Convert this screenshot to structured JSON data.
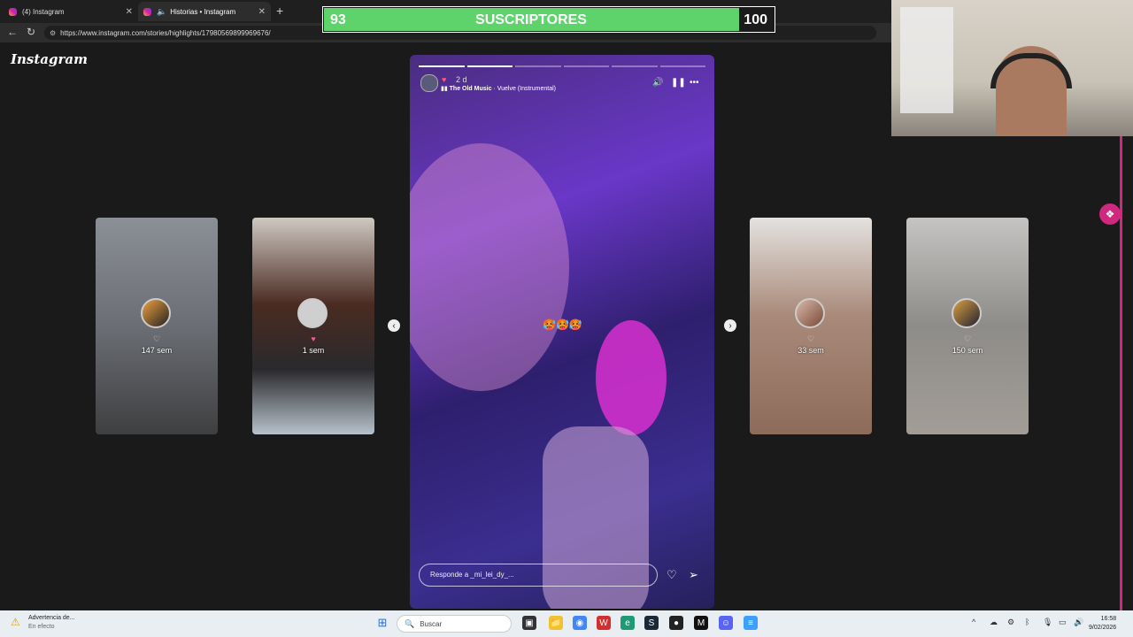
{
  "browser": {
    "tabs": [
      {
        "label": "(4) Instagram",
        "active": false
      },
      {
        "label": "Historias • Instagram",
        "active": true
      }
    ],
    "url": "https://www.instagram.com/stories/highlights/17980569899969676/"
  },
  "overlay": {
    "current": "93",
    "label": "SUSCRIPTORES",
    "goal": "100",
    "progress_fraction": 0.93,
    "fill_color": "#5fd36b"
  },
  "instagram": {
    "logo": "Instagram",
    "side_stories": [
      {
        "heart": "♡",
        "age": "147 sem"
      },
      {
        "heart": "♥",
        "age": "1 sem"
      },
      {
        "heart": "♡",
        "age": "33 sem"
      },
      {
        "heart": "♡",
        "age": "150 sem"
      }
    ],
    "story": {
      "time": "2 d",
      "music_title": "The Old Music",
      "music_sub": " · Vuelve (Instrumental)",
      "emojis": "🥵🥵🥵",
      "reply_placeholder": "Responde a _mi_lei_dy_..."
    }
  },
  "taskbar": {
    "warning_title": "Advertencia de...",
    "warning_sub": "En efecto",
    "search_label": "Buscar",
    "time": "16:58",
    "date": "9/02/2026"
  }
}
